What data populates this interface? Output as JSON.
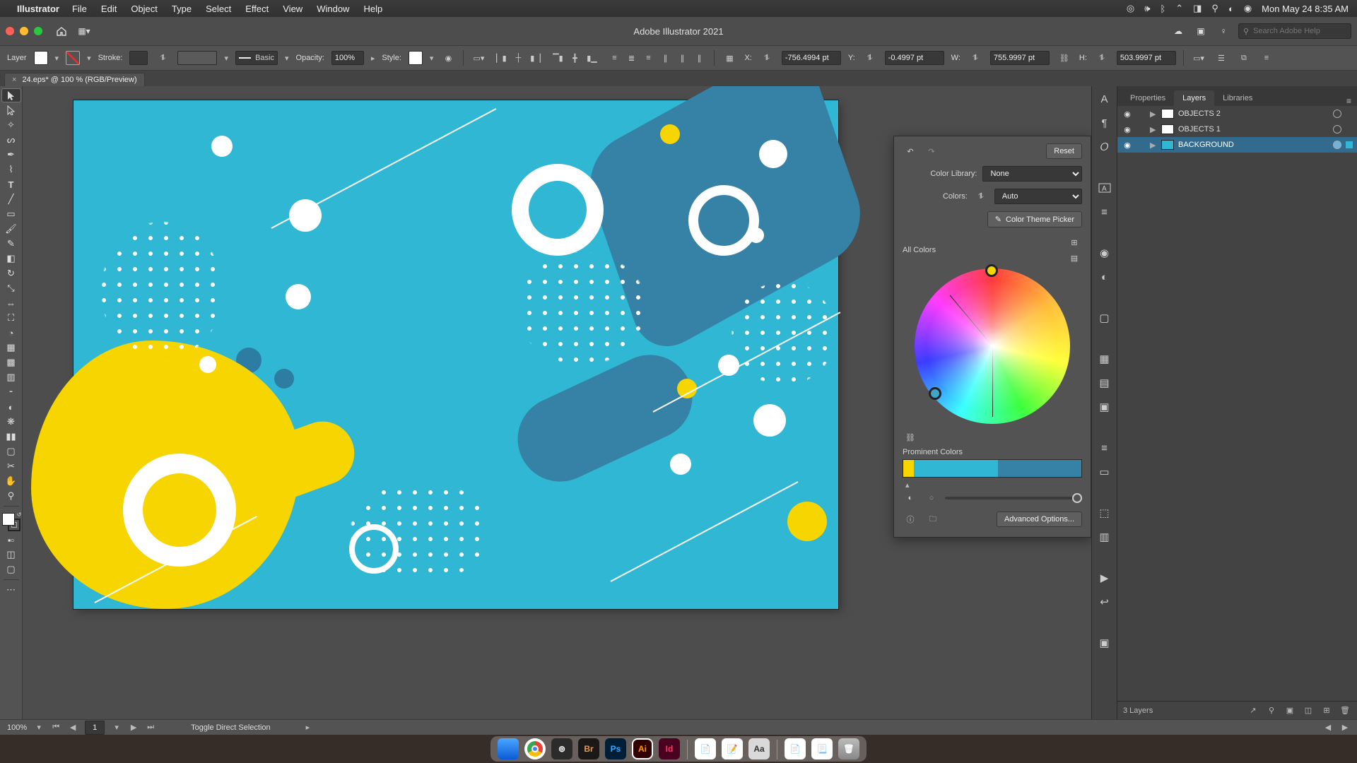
{
  "menubar": {
    "app_name": "Illustrator",
    "items": [
      "File",
      "Edit",
      "Object",
      "Type",
      "Select",
      "Effect",
      "View",
      "Window",
      "Help"
    ],
    "datetime": "Mon May 24  8:35 AM"
  },
  "appbar": {
    "title": "Adobe Illustrator 2021",
    "search_placeholder": "Search Adobe Help"
  },
  "control": {
    "target": "Layer",
    "stroke_label": "Stroke:",
    "stroke_pt": "",
    "stroke_style": "Basic",
    "opacity_label": "Opacity:",
    "opacity_value": "100%",
    "style_label": "Style:",
    "x_label": "X:",
    "x_value": "-756.4994 pt",
    "y_label": "Y:",
    "y_value": "-0.4997 pt",
    "w_label": "W:",
    "w_value": "755.9997 pt",
    "h_label": "H:",
    "h_value": "503.9997 pt"
  },
  "doc_tab": {
    "label": "24.eps* @ 100 % (RGB/Preview)"
  },
  "recolor": {
    "reset": "Reset",
    "lib_label": "Color Library:",
    "lib_value": "None",
    "colors_label": "Colors:",
    "colors_value": "Auto",
    "picker": "Color Theme Picker",
    "all_colors": "All Colors",
    "prominent": "Prominent Colors",
    "advanced": "Advanced Options...",
    "swatches": [
      {
        "color": "#f6d500",
        "pct": 6
      },
      {
        "color": "#2fb7d4",
        "pct": 47
      },
      {
        "color": "#3681a6",
        "pct": 47
      }
    ]
  },
  "panels": {
    "tabs": [
      "Properties",
      "Layers",
      "Libraries"
    ],
    "active_tab": 1,
    "layers": [
      {
        "name": "OBJECTS 2",
        "thumb": "#ffffff",
        "selected": false
      },
      {
        "name": "OBJECTS 1",
        "thumb": "#ffffff",
        "selected": false
      },
      {
        "name": "BACKGROUND",
        "thumb": "#2fb7d4",
        "selected": true
      }
    ],
    "footer_count": "3 Layers"
  },
  "status": {
    "zoom": "100%",
    "artboard": "1",
    "hint": "Toggle Direct Selection"
  },
  "dock_apps": [
    "Finder",
    "Chrome",
    "CC",
    "Br",
    "Ps",
    "Ai",
    "Id"
  ]
}
